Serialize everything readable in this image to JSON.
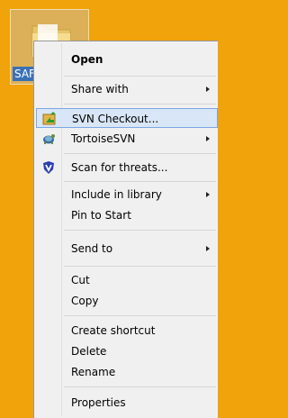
{
  "desktop": {
    "folder_label": "SAF"
  },
  "menu": {
    "items": [
      {
        "label": "Open",
        "bold": true,
        "submenu": false,
        "icon": ""
      },
      {
        "label": "Share with",
        "bold": false,
        "submenu": true,
        "icon": ""
      },
      {
        "label": "SVN Checkout...",
        "bold": false,
        "submenu": false,
        "icon": "svn-checkout-icon",
        "highlighted": true
      },
      {
        "label": "TortoiseSVN",
        "bold": false,
        "submenu": true,
        "icon": "tortoise-icon"
      },
      {
        "label": "Scan for threats...",
        "bold": false,
        "submenu": false,
        "icon": "shield-icon"
      },
      {
        "label": "Include in library",
        "bold": false,
        "submenu": true,
        "icon": ""
      },
      {
        "label": "Pin to Start",
        "bold": false,
        "submenu": false,
        "icon": ""
      },
      {
        "label": "Send to",
        "bold": false,
        "submenu": true,
        "icon": ""
      },
      {
        "label": "Cut",
        "bold": false,
        "submenu": false,
        "icon": ""
      },
      {
        "label": "Copy",
        "bold": false,
        "submenu": false,
        "icon": ""
      },
      {
        "label": "Create shortcut",
        "bold": false,
        "submenu": false,
        "icon": ""
      },
      {
        "label": "Delete",
        "bold": false,
        "submenu": false,
        "icon": ""
      },
      {
        "label": "Rename",
        "bold": false,
        "submenu": false,
        "icon": ""
      },
      {
        "label": "Properties",
        "bold": false,
        "submenu": false,
        "icon": ""
      }
    ]
  },
  "colors": {
    "desktop_background": "#f0a30a",
    "menu_background": "#f0f0f0",
    "highlight_fill": "#d9e6f7",
    "highlight_border": "#7aa7e6"
  }
}
